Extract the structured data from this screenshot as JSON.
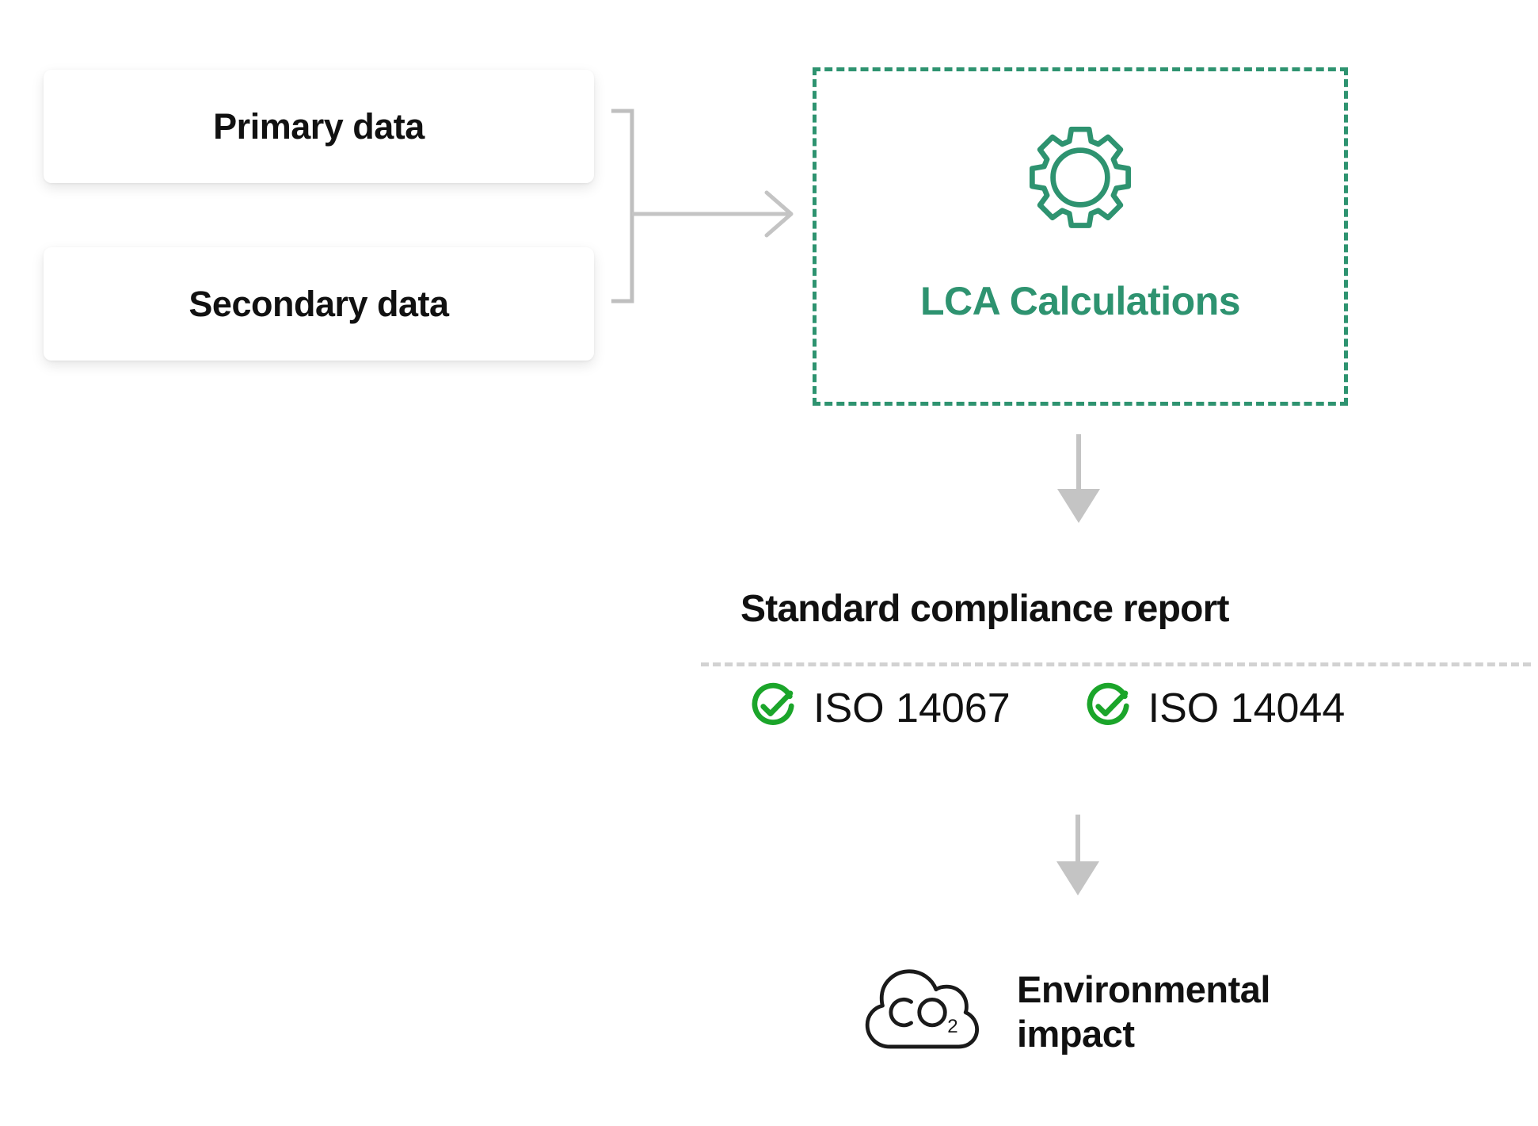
{
  "diagram": {
    "inputs": [
      {
        "id": "primary",
        "label": "Primary data"
      },
      {
        "id": "secondary",
        "label": "Secondary data"
      }
    ],
    "process": {
      "label": "LCA Calculations",
      "icon": "gear-icon",
      "border_style": "dashed",
      "accent_color": "#2E9370"
    },
    "report": {
      "title": "Standard compliance report",
      "divider_style": "dashed",
      "divider_color": "#D2D2D2",
      "badges": [
        {
          "icon": "check-circle-icon",
          "label": "ISO 14067",
          "color": "#1BA52A"
        },
        {
          "icon": "check-circle-icon",
          "label": "ISO 14044",
          "color": "#1BA52A"
        }
      ]
    },
    "outcome": {
      "icon": "co2-cloud-icon",
      "icon_text": "CO",
      "icon_subscript": "2",
      "label": "Environmental\nimpact"
    },
    "connectors": {
      "bracket_color": "#BFBFBF",
      "arrow_color": "#C4C4C4"
    }
  }
}
